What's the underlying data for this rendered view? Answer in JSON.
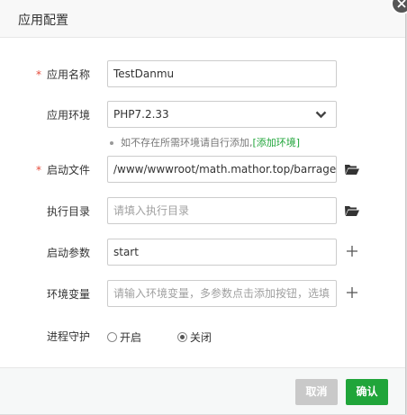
{
  "dialog": {
    "title": "应用配置"
  },
  "form": {
    "app_name": {
      "label": "应用名称",
      "required": "*",
      "value": "TestDanmu"
    },
    "app_env": {
      "label": "应用环境",
      "value": "PHP7.2.33"
    },
    "hint": {
      "text": "如不存在所需环境请自行添加,",
      "link": "[添加环境]"
    },
    "start_file": {
      "label": "启动文件",
      "required": "*",
      "value": "/www/wwwroot/math.mathor.top/barrage/"
    },
    "exec_dir": {
      "label": "执行目录",
      "placeholder": "请填入执行目录"
    },
    "start_args": {
      "label": "启动参数",
      "value": "start"
    },
    "env_vars": {
      "label": "环境变量",
      "placeholder": "请输入环境变量，多参数点击添加按钮，选填"
    },
    "daemon": {
      "label": "进程守护",
      "options": [
        "开启",
        "关闭"
      ],
      "selected": "关闭"
    }
  },
  "footer": {
    "cancel_label": "取消",
    "ok_label": "确认"
  },
  "colors": {
    "accent": "#20a53a",
    "required": "#e64b3b",
    "cancel": "#c9c9c9"
  },
  "icons": [
    "close-icon",
    "chevron-down-icon",
    "folder-icon",
    "plus-icon"
  ]
}
